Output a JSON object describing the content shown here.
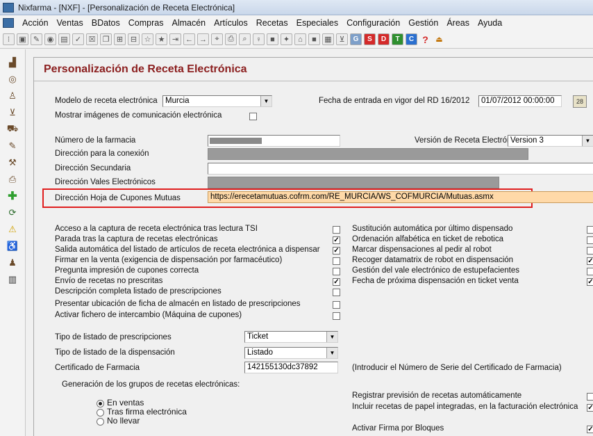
{
  "window": {
    "title": "Nixfarma - [NXF] - [Personalización de Receta Electrónica]"
  },
  "menu": [
    "Acción",
    "Ventas",
    "BDatos",
    "Compras",
    "Almacén",
    "Artículos",
    "Recetas",
    "Especiales",
    "Configuración",
    "Gestión",
    "Áreas",
    "Ayuda"
  ],
  "toolbar": {
    "letter_buttons": [
      {
        "label": "G",
        "color": "#7d9fc9"
      },
      {
        "label": "S",
        "color": "#d42a2a"
      },
      {
        "label": "D",
        "color": "#d42a2a"
      },
      {
        "label": "T",
        "color": "#2f8f2f"
      },
      {
        "label": "C",
        "color": "#2a6fcf"
      }
    ],
    "help_label": "?"
  },
  "page": {
    "title": "Personalización de Receta Electrónica"
  },
  "form": {
    "modelo_label": "Modelo de receta electrónica",
    "modelo_value": "Murcia",
    "fecha_label": "Fecha de entrada en vigor del RD 16/2012",
    "fecha_value": "01/07/2012 00:00:00",
    "mostrar_imagenes_label": "Mostrar imágenes de comunicación electrónica",
    "numero_farmacia_label": "Número de la farmacia",
    "version_label": "Versión de Receta Electrónica",
    "version_value": "Version 3",
    "direccion_conexion_label": "Dirección para la conexión",
    "direccion_secundaria_label": "Dirección Secundaria",
    "direccion_vales_label": "Dirección Vales Electrónicos",
    "direccion_cupones_label": "Dirección Hoja de Cupones Mutuas",
    "direccion_cupones_value": "https://erecetamutuas.cofrm.com/RE_MURCIA/WS_COFMURCIA/Mutuas.asmx"
  },
  "left_checks": [
    {
      "label": "Acceso a la captura de receta electrónica tras lectura TSI",
      "checked": false
    },
    {
      "label": "Parada tras la captura de recetas electrónicas",
      "checked": true
    },
    {
      "label": "Salida automática del listado de artículos de receta electrónica a dispensar",
      "checked": true
    },
    {
      "label": "Firmar en la venta (exigencia de dispensación por farmacéutico)",
      "checked": false
    },
    {
      "label": "Pregunta impresión de cupones correcta",
      "checked": false
    },
    {
      "label": "Envío de recetas no prescritas",
      "checked": true
    },
    {
      "label": "Descripción completa listado de prescripciones",
      "checked": false
    },
    {
      "label": "Presentar ubicación de ficha de almacén en listado de prescripciones",
      "checked": false
    },
    {
      "label": "Activar fichero de intercambio (Máquina de cupones)",
      "checked": false
    }
  ],
  "right_checks": [
    {
      "label": "Sustitución automática por último dispensado",
      "checked": false
    },
    {
      "label": "Ordenación alfabética en ticket de rebotica",
      "checked": false
    },
    {
      "label": "Marcar dispensaciones al pedir al robot",
      "checked": false
    },
    {
      "label": "Recoger datamatrix de robot en dispensación",
      "checked": true
    },
    {
      "label": "Gestión del vale electrónico de estupefacientes",
      "checked": false
    },
    {
      "label": "Fecha de próxima dispensación en ticket venta",
      "checked": true
    }
  ],
  "bottom": {
    "tipo_prescripciones_label": "Tipo de listado de prescripciones",
    "tipo_prescripciones_value": "Ticket",
    "tipo_dispensacion_label": "Tipo de listado de la dispensación",
    "tipo_dispensacion_value": "Listado",
    "certificado_label": "Certificado de Farmacia",
    "certificado_value": "142155130dc37892",
    "certificado_hint": "(Introducir el Número de Serie del Certificado de Farmacia)",
    "generacion_label": "Generación de los grupos de recetas electrónicas:",
    "radio_options": [
      {
        "label": "En ventas",
        "selected": true
      },
      {
        "label": "Tras firma electrónica",
        "selected": false
      },
      {
        "label": "No llevar",
        "selected": false
      }
    ],
    "registrar_label": "Registrar previsión de recetas automáticamente",
    "registrar_checked": false,
    "incluir_label": "Incluir recetas de papel integradas, en la facturación electrónica",
    "incluir_checked": true,
    "firma_bloques_label": "Activar Firma por Bloques",
    "firma_bloques_checked": true
  }
}
